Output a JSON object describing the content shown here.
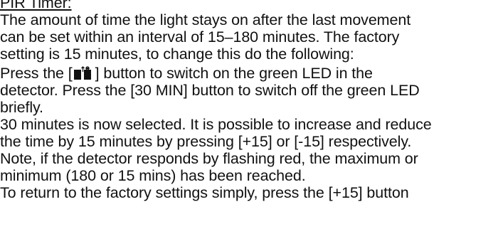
{
  "heading": "PIR Timer:",
  "paragraphs": [
    {
      "lines": [
        "The amount of time the light stays on after the last movement",
        "can be set within an interval of 15–180 minutes. The factory",
        "setting is 15 minutes, to change this do the following:"
      ]
    },
    {
      "line1_before": "Press the [",
      "line1_after": "] button to switch on the green LED in the",
      "lines": [
        "detector. Press the [30 MIN] button to switch off the green LED",
        "briefly."
      ],
      "icon": "timer-button-icon"
    },
    {
      "lines": [
        "30 minutes is now selected. It is possible to increase and reduce",
        "the time by 15 minutes by pressing [+15] or [-15] respectively.",
        "Note, if the detector responds by flashing red, the maximum or",
        "minimum (180 or 15 mins) has been reached."
      ]
    },
    {
      "lines": [
        "To return to the factory settings simply, press the [+15] button"
      ]
    }
  ]
}
